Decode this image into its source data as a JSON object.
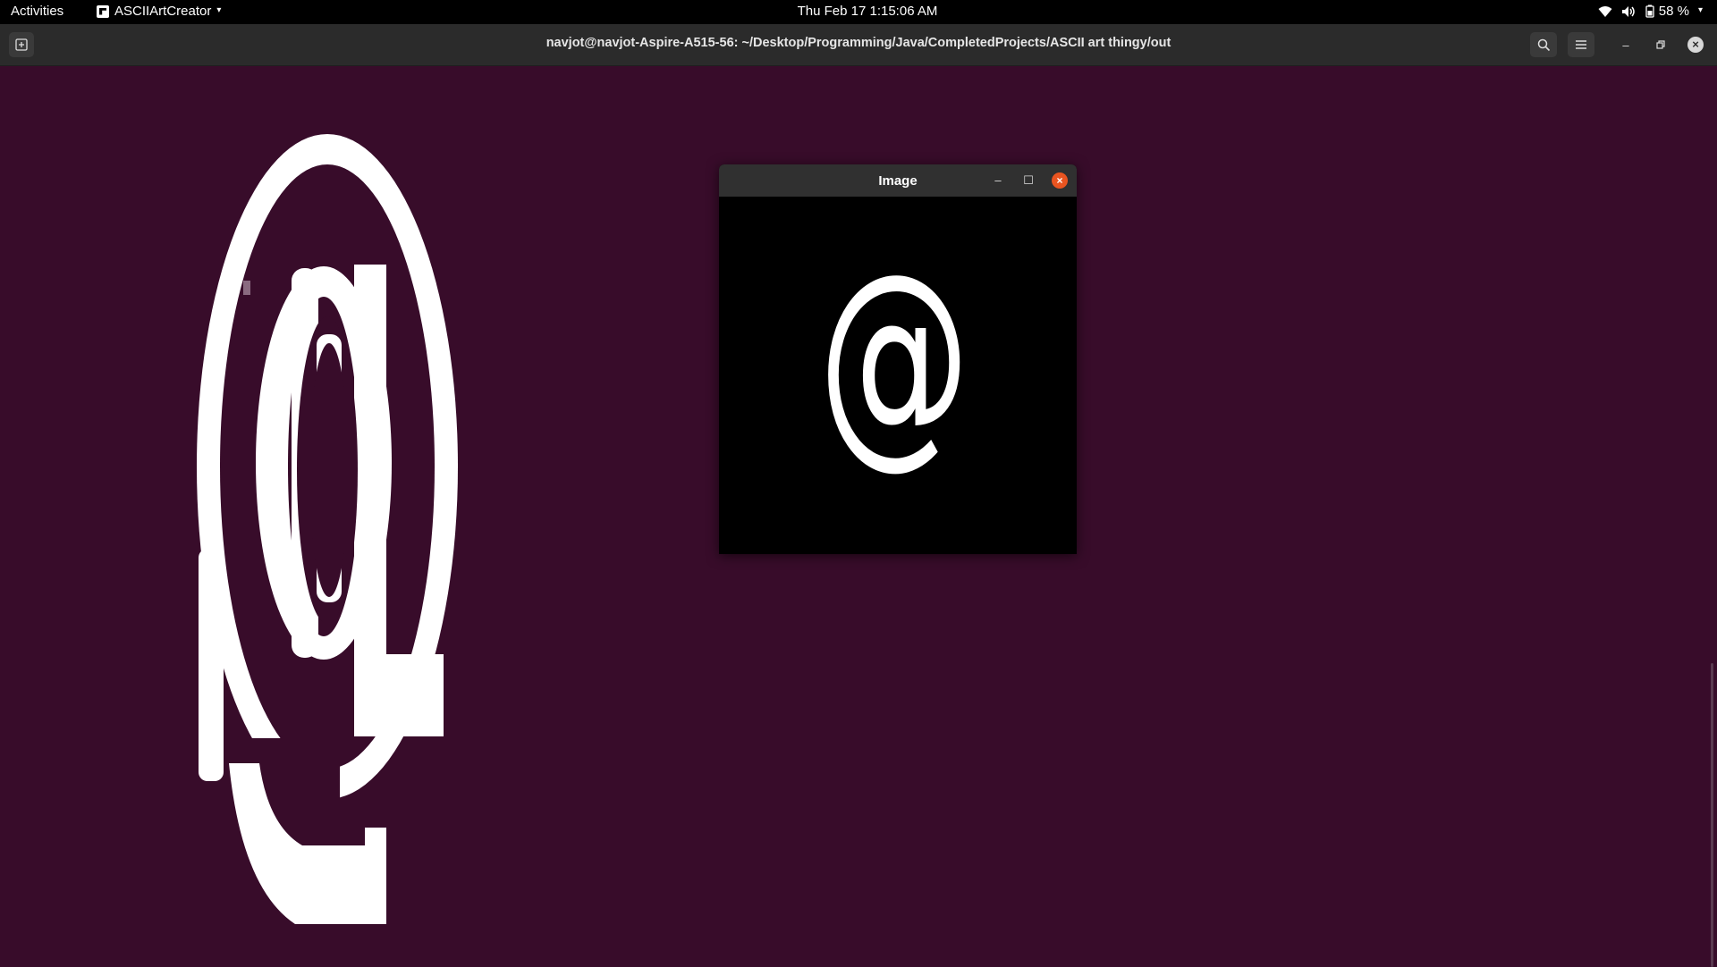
{
  "topbar": {
    "activities": "Activities",
    "app_name": "ASCIIArtCreator",
    "clock": "Thu Feb 17  1:15:06 AM",
    "battery": "58 %"
  },
  "terminal": {
    "title": "navjot@navjot-Aspire-A515-56: ~/Desktop/Programming/Java/CompletedProjects/ASCII art thingy/out",
    "output_description": "ASCII art rendering of @ symbol using white block characters"
  },
  "image_window": {
    "title": "Image",
    "content_glyph": "@"
  },
  "colors": {
    "terminal_bg": "#380c2a",
    "header_bg": "#2b2b2b",
    "close_accent": "#e95420",
    "art_color": "#ffffff"
  },
  "icons": {
    "new_tab": "new-tab-icon",
    "search": "search-icon",
    "menu": "hamburger-menu-icon",
    "minimize": "minimize-icon",
    "maximize": "maximize-icon",
    "close": "close-icon",
    "wifi": "wifi-icon",
    "volume": "volume-icon",
    "battery": "battery-icon"
  }
}
